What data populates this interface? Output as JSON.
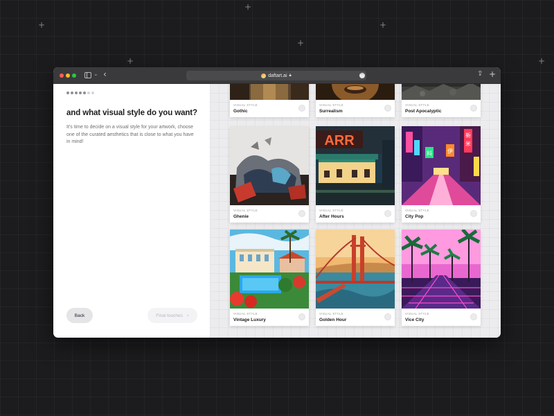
{
  "browser": {
    "url": "daftart.ai"
  },
  "onboarding": {
    "heading": "and what visual style do you want?",
    "description": "It's time to decide on a visual style for your artwork, choose one of the curated aesthetics that is close to what you have in mind!",
    "back_label": "Back",
    "next_label": "Final touches",
    "steps_total": 7,
    "steps_completed": 5
  },
  "styles": {
    "tag": "VISUAL STYLE",
    "items": [
      {
        "name": "Gothic",
        "selected": false
      },
      {
        "name": "Surrealism",
        "selected": false
      },
      {
        "name": "Post Apocalyptic",
        "selected": false
      },
      {
        "name": "Ghenie",
        "selected": false
      },
      {
        "name": "After Hours",
        "selected": false
      },
      {
        "name": "City Pop",
        "selected": false
      },
      {
        "name": "Vintage Luxury",
        "selected": false
      },
      {
        "name": "Golden Hour",
        "selected": false
      },
      {
        "name": "Vice City",
        "selected": false
      }
    ]
  },
  "artwork": {
    "after_hours_sign": "ARR",
    "city_pop_signs": [
      "新",
      "米",
      "料",
      "伊"
    ]
  },
  "colors": {
    "titlebar": "#3a3a3c",
    "page_bg": "#1c1c1e",
    "panel_bg": "#ececee"
  }
}
